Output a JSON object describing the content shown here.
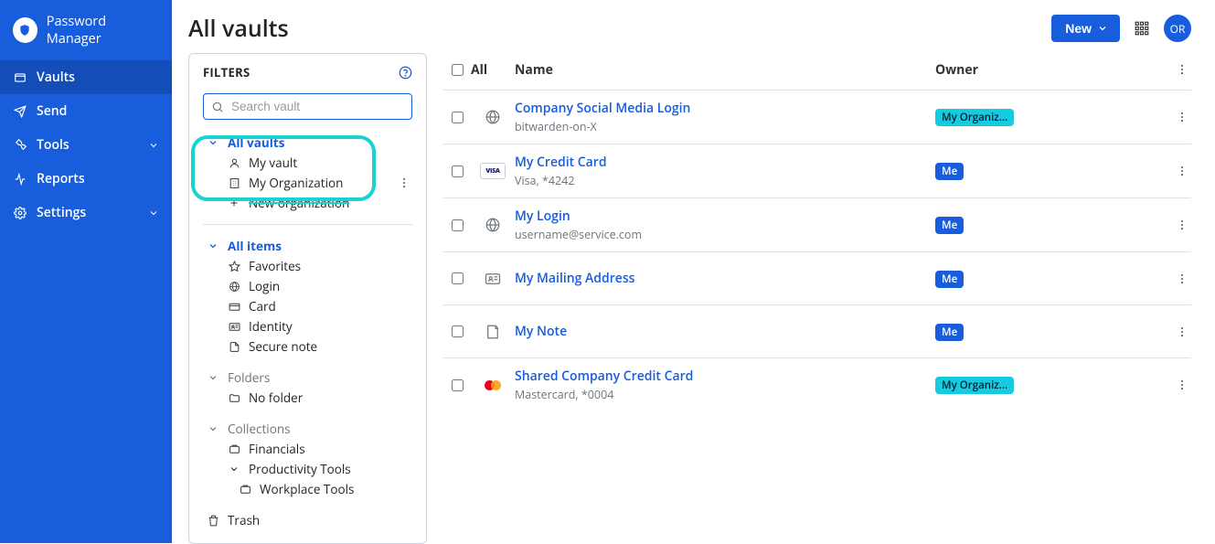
{
  "brand": {
    "name": "Password Manager"
  },
  "nav": {
    "vaults": "Vaults",
    "send": "Send",
    "tools": "Tools",
    "reports": "Reports",
    "settings": "Settings"
  },
  "header": {
    "title": "All vaults",
    "new_label": "New",
    "avatar_initials": "OR"
  },
  "filters": {
    "header": "FILTERS",
    "search_placeholder": "Search vault",
    "vaults": {
      "all": "All vaults",
      "mine": "My vault",
      "org": "My Organization",
      "new_org": "New organization"
    },
    "items": {
      "all": "All items",
      "favorites": "Favorites",
      "login": "Login",
      "card": "Card",
      "identity": "Identity",
      "secure_note": "Secure note"
    },
    "folders": {
      "header": "Folders",
      "no_folder": "No folder"
    },
    "collections": {
      "header": "Collections",
      "financials": "Financials",
      "productivity": "Productivity Tools",
      "workplace": "Workplace Tools"
    },
    "trash": "Trash"
  },
  "table": {
    "headers": {
      "all": "All",
      "name": "Name",
      "owner": "Owner"
    },
    "rows": [
      {
        "name": "Company Social Media Login",
        "sub": "bitwarden-on-X",
        "owner": "My Organiz...",
        "owner_type": "org",
        "icon": "globe"
      },
      {
        "name": "My Credit Card",
        "sub": "Visa, *4242",
        "owner": "Me",
        "owner_type": "me",
        "icon": "visa"
      },
      {
        "name": "My Login",
        "sub": "username@service.com",
        "owner": "Me",
        "owner_type": "me",
        "icon": "globe"
      },
      {
        "name": "My Mailing Address",
        "sub": "",
        "owner": "Me",
        "owner_type": "me",
        "icon": "id"
      },
      {
        "name": "My Note",
        "sub": "",
        "owner": "Me",
        "owner_type": "me",
        "icon": "note"
      },
      {
        "name": "Shared Company Credit Card",
        "sub": "Mastercard, *0004",
        "owner": "My Organiz...",
        "owner_type": "org",
        "icon": "mc"
      }
    ]
  }
}
